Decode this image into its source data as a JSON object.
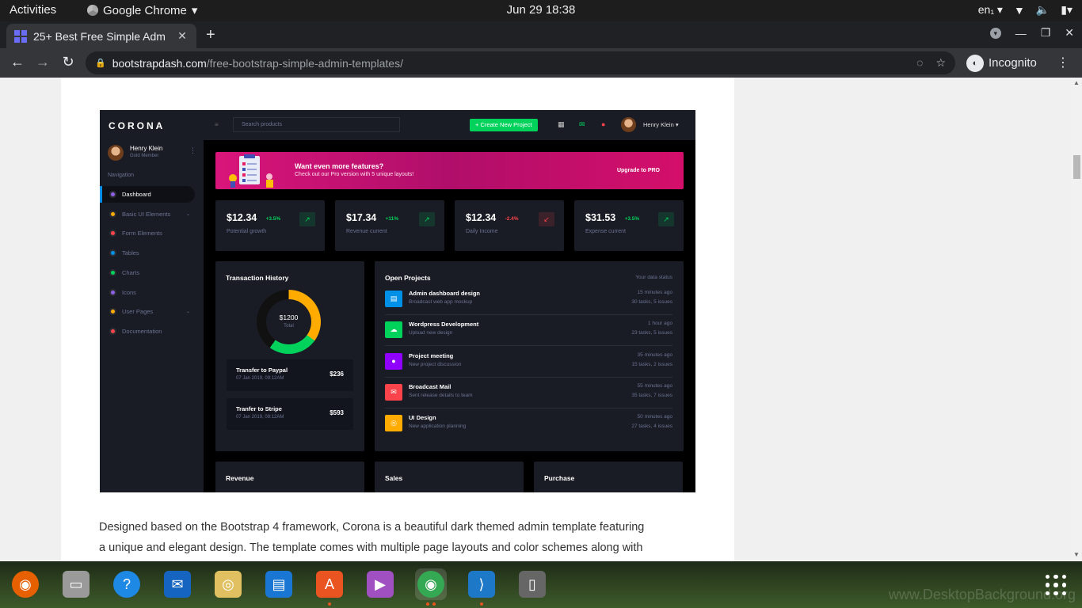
{
  "topbar": {
    "activities": "Activities",
    "app_name": "Google Chrome",
    "clock": "Jun 29  18:38",
    "lang": "en₁"
  },
  "tab": {
    "title": "25+ Best Free Simple Adm",
    "close": "✕",
    "new_tab": "+"
  },
  "toolbar": {
    "url_domain": "bootstrapdash.com",
    "url_path": "/free-bootstrap-simple-admin-templates/",
    "incognito_label": "Incognito"
  },
  "corona": {
    "logo": "CORONA",
    "search_placeholder": "Search products",
    "create_button": "+ Create New Project",
    "user_name": "Henry Klein",
    "profile": {
      "name": "Henry Klein",
      "role": "Gold Member"
    },
    "nav_heading": "Navigation",
    "nav": [
      {
        "label": "Dashboard",
        "color": "#8f5fe8",
        "active": true,
        "arrow": false
      },
      {
        "label": "Basic UI Elements",
        "color": "#ffab00",
        "active": false,
        "arrow": true
      },
      {
        "label": "Form Elements",
        "color": "#fc424a",
        "active": false,
        "arrow": false
      },
      {
        "label": "Tables",
        "color": "#0090e7",
        "active": false,
        "arrow": false
      },
      {
        "label": "Charts",
        "color": "#00d25b",
        "active": false,
        "arrow": false
      },
      {
        "label": "Icons",
        "color": "#8f5fe8",
        "active": false,
        "arrow": false
      },
      {
        "label": "User Pages",
        "color": "#ffab00",
        "active": false,
        "arrow": true
      },
      {
        "label": "Documentation",
        "color": "#fc424a",
        "active": false,
        "arrow": false
      }
    ],
    "banner": {
      "title": "Want even more features?",
      "subtitle": "Check out our Pro version with 5 unique layouts!",
      "cta": "Upgrade to PRO"
    },
    "stats": [
      {
        "value": "$12.34",
        "change": "+3.5%",
        "trend": "up",
        "label": "Potential growth"
      },
      {
        "value": "$17.34",
        "change": "+11%",
        "trend": "up",
        "label": "Revenue current"
      },
      {
        "value": "$12.34",
        "change": "-2.4%",
        "trend": "down",
        "label": "Daily Income"
      },
      {
        "value": "$31.53",
        "change": "+3.5%",
        "trend": "up",
        "label": "Expense current"
      }
    ],
    "transactions": {
      "title": "Transaction History",
      "donut_amount": "$1200",
      "donut_label": "Total",
      "segments": [
        {
          "value": 0.35,
          "color": "#ffab00"
        },
        {
          "value": 0.25,
          "color": "#00d25b"
        },
        {
          "value": 0.4,
          "color": "#111111"
        }
      ],
      "items": [
        {
          "name": "Transfer to Paypal",
          "date": "07 Jan 2019, 09:12AM",
          "amount": "$236"
        },
        {
          "name": "Tranfer to Stripe",
          "date": "07 Jan 2019, 09:12AM",
          "amount": "$593"
        }
      ]
    },
    "projects": {
      "title": "Open Projects",
      "status_label": "Your data status",
      "items": [
        {
          "name": "Admin dashboard design",
          "sub": "Broadcast web app mockup",
          "time": "15 minutes ago",
          "tasks": "30 tasks, 5 issues",
          "color": "#0090e7",
          "icon": "▤"
        },
        {
          "name": "Wordpress Development",
          "sub": "Upload new design",
          "time": "1 hour ago",
          "tasks": "23 tasks, 5 issues",
          "color": "#00d25b",
          "icon": "☁"
        },
        {
          "name": "Project meeting",
          "sub": "New project discussion",
          "time": "35 minutes ago",
          "tasks": "15 tasks, 2 issues",
          "color": "#8f00ff",
          "icon": "●"
        },
        {
          "name": "Broadcast Mail",
          "sub": "Sent release details to team",
          "time": "55 minutes ago",
          "tasks": "35 tasks, 7 issues",
          "color": "#fc424a",
          "icon": "✉"
        },
        {
          "name": "UI Design",
          "sub": "New application planning",
          "time": "50 minutes ago",
          "tasks": "27 tasks, 4 issues",
          "color": "#ffab00",
          "icon": "◎"
        }
      ]
    },
    "bottom_cards": [
      "Revenue",
      "Sales",
      "Purchase"
    ]
  },
  "article": {
    "line1": "Designed based on the Bootstrap 4 framework, Corona is a beautiful dark themed admin template featuring",
    "line2": "a unique and elegant design. The template comes with multiple page layouts and color schemes along with"
  },
  "dock": {
    "apps": [
      {
        "name": "firefox-icon",
        "bg": "#e66000",
        "glyph": "◉"
      },
      {
        "name": "files-icon",
        "bg": "#9a9a9a",
        "glyph": "▭"
      },
      {
        "name": "help-icon",
        "bg": "#1e88e5",
        "glyph": "?"
      },
      {
        "name": "thunderbird-icon",
        "bg": "#1565c0",
        "glyph": "✉"
      },
      {
        "name": "rhythmbox-icon",
        "bg": "#e0c060",
        "glyph": "◎"
      },
      {
        "name": "libreoffice-writer-icon",
        "bg": "#1976d2",
        "glyph": "▤"
      },
      {
        "name": "software-center-icon",
        "bg": "#e95420",
        "glyph": "A"
      },
      {
        "name": "video-player-icon",
        "bg": "#a050c0",
        "glyph": "▶"
      },
      {
        "name": "chrome-icon",
        "bg": "#34a853",
        "glyph": "◉"
      },
      {
        "name": "vscode-icon",
        "bg": "#1e78c8",
        "glyph": "⟩"
      },
      {
        "name": "device-icon",
        "bg": "#666666",
        "glyph": "▯"
      }
    ],
    "watermark": "www.DesktopBackground.org"
  }
}
